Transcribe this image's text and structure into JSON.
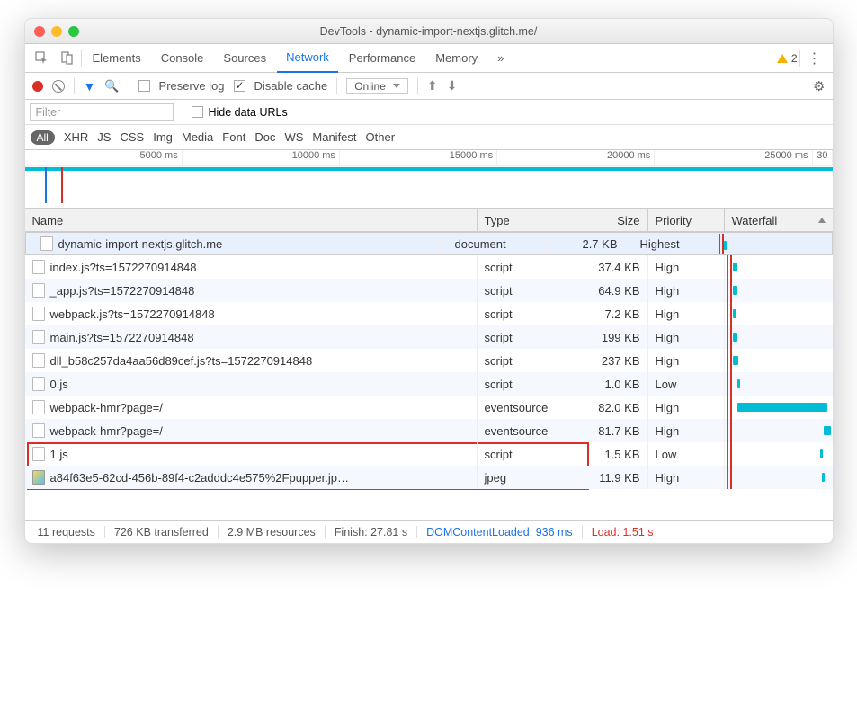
{
  "window": {
    "title": "DevTools - dynamic-import-nextjs.glitch.me/"
  },
  "tabs": {
    "t0": "Elements",
    "t1": "Console",
    "t2": "Sources",
    "t3": "Network",
    "t4": "Performance",
    "t5": "Memory",
    "more": "»",
    "warnCount": "2"
  },
  "toolbar": {
    "preserve": "Preserve log",
    "disable": "Disable cache",
    "connection": "Online"
  },
  "filter": {
    "placeholder": "Filter",
    "hide": "Hide data URLs"
  },
  "types": {
    "all": "All",
    "xhr": "XHR",
    "js": "JS",
    "css": "CSS",
    "img": "Img",
    "media": "Media",
    "font": "Font",
    "doc": "Doc",
    "ws": "WS",
    "manifest": "Manifest",
    "other": "Other"
  },
  "timeline": {
    "t1": "5000 ms",
    "t2": "10000 ms",
    "t3": "15000 ms",
    "t4": "20000 ms",
    "t5": "25000 ms",
    "t6": "30"
  },
  "cols": {
    "name": "Name",
    "type": "Type",
    "size": "Size",
    "priority": "Priority",
    "waterfall": "Waterfall"
  },
  "rows": [
    {
      "name": "dynamic-import-nextjs.glitch.me",
      "type": "document",
      "size": "2.7 KB",
      "priority": "Highest",
      "wfL": 8,
      "wfW": 3
    },
    {
      "name": "index.js?ts=1572270914848",
      "type": "script",
      "size": "37.4 KB",
      "priority": "High",
      "wfL": 9,
      "wfW": 5
    },
    {
      "name": "_app.js?ts=1572270914848",
      "type": "script",
      "size": "64.9 KB",
      "priority": "High",
      "wfL": 9,
      "wfW": 5
    },
    {
      "name": "webpack.js?ts=1572270914848",
      "type": "script",
      "size": "7.2 KB",
      "priority": "High",
      "wfL": 9,
      "wfW": 4
    },
    {
      "name": "main.js?ts=1572270914848",
      "type": "script",
      "size": "199 KB",
      "priority": "High",
      "wfL": 9,
      "wfW": 5
    },
    {
      "name": "dll_b58c257da4aa56d89cef.js?ts=1572270914848",
      "type": "script",
      "size": "237 KB",
      "priority": "High",
      "wfL": 9,
      "wfW": 6
    },
    {
      "name": "0.js",
      "type": "script",
      "size": "1.0 KB",
      "priority": "Low",
      "wfL": 14,
      "wfW": 3
    },
    {
      "name": "webpack-hmr?page=/",
      "type": "eventsource",
      "size": "82.0 KB",
      "priority": "High",
      "wfL": 14,
      "wfW": 100
    },
    {
      "name": "webpack-hmr?page=/",
      "type": "eventsource",
      "size": "81.7 KB",
      "priority": "High",
      "wfL": 110,
      "wfW": 8
    },
    {
      "name": "1.js",
      "type": "script",
      "size": "1.5 KB",
      "priority": "Low",
      "wfL": 106,
      "wfW": 3
    },
    {
      "name": "a84f63e5-62cd-456b-89f4-c2adddc4e575%2Fpupper.jp…",
      "type": "jpeg",
      "size": "11.9 KB",
      "priority": "High",
      "wfL": 108,
      "wfW": 3,
      "img": true
    }
  ],
  "status": {
    "requests": "11 requests",
    "transferred": "726 KB transferred",
    "resources": "2.9 MB resources",
    "finish": "Finish: 27.81 s",
    "dom": "DOMContentLoaded: 936 ms",
    "load": "Load: 1.51 s"
  }
}
